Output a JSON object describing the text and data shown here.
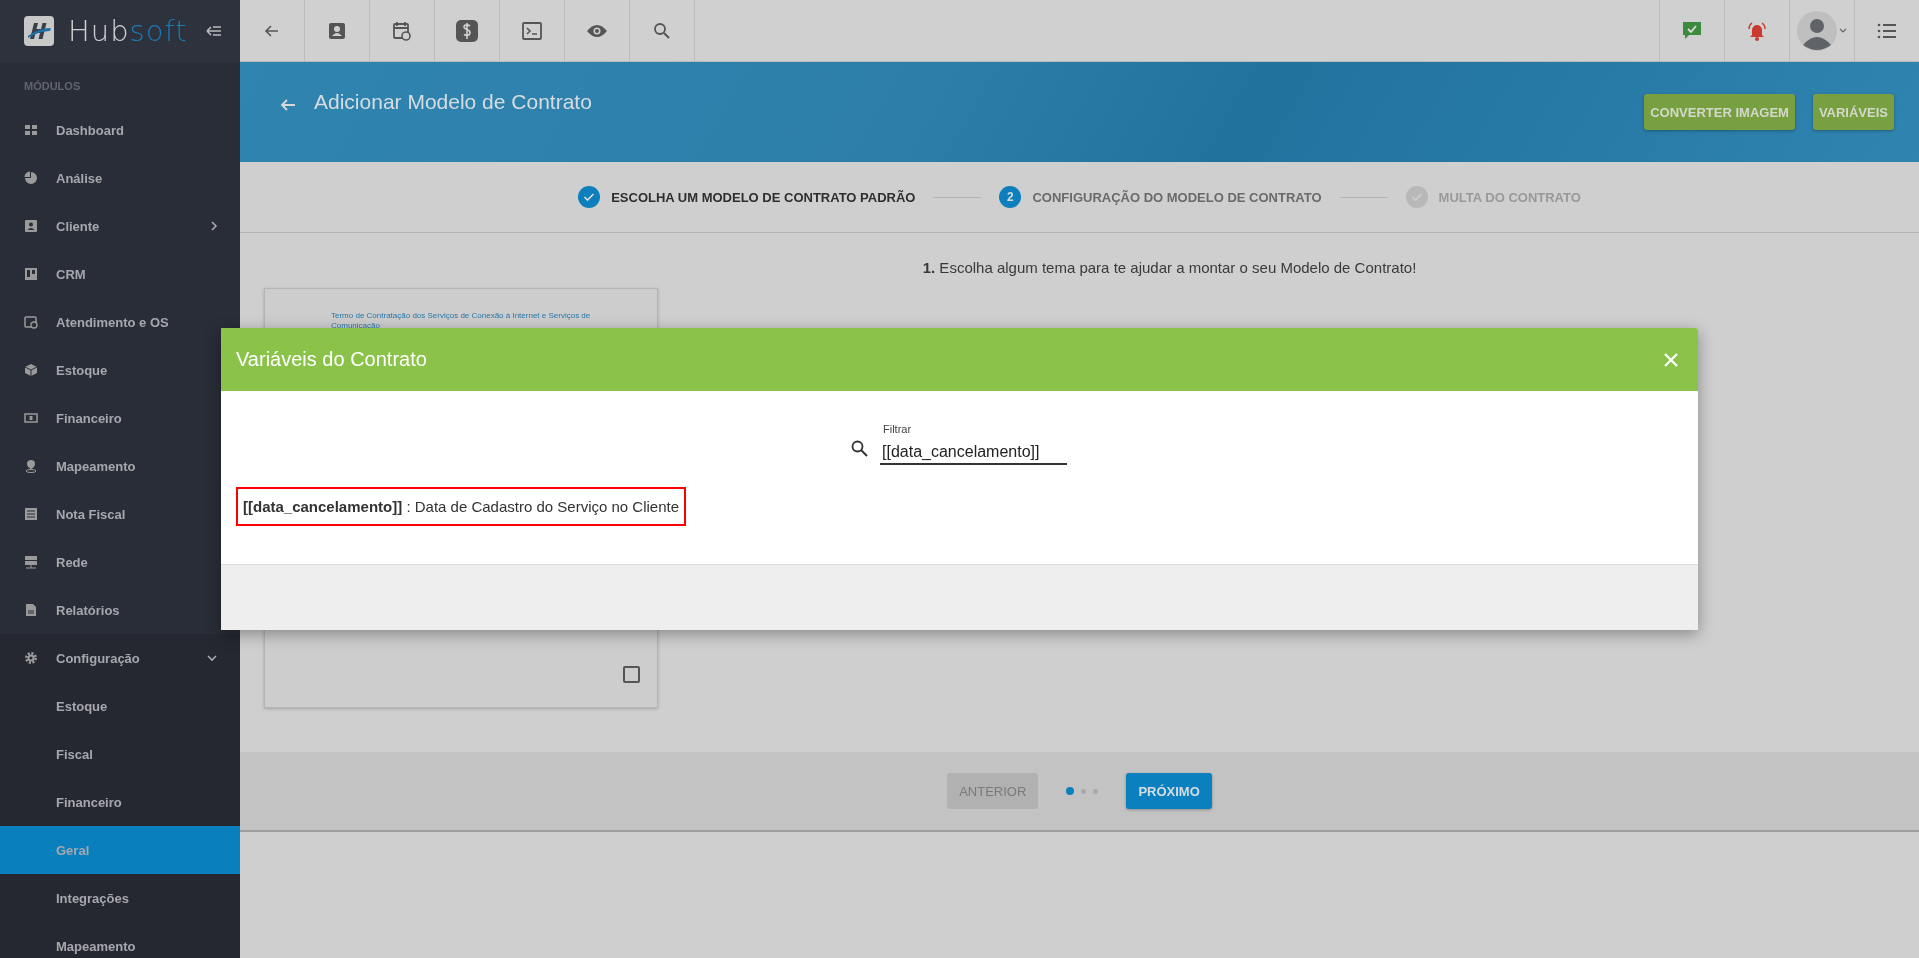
{
  "sidebar": {
    "brand_main": "Hub",
    "brand_accent": "soft",
    "section_label": "MÓDULOS",
    "items": [
      {
        "label": "Dashboard",
        "selected": false
      },
      {
        "label": "Análise",
        "selected": false
      },
      {
        "label": "Cliente",
        "selected": false,
        "expanded": false
      },
      {
        "label": "CRM",
        "selected": false
      },
      {
        "label": "Atendimento e OS",
        "selected": false
      },
      {
        "label": "Estoque",
        "selected": false
      },
      {
        "label": "Financeiro",
        "selected": false
      },
      {
        "label": "Mapeamento",
        "selected": false
      },
      {
        "label": "Nota Fiscal",
        "selected": false
      },
      {
        "label": "Rede",
        "selected": false
      },
      {
        "label": "Relatórios",
        "selected": false
      },
      {
        "label": "Configuração",
        "selected": false,
        "expanded": true,
        "children": [
          {
            "label": "Estoque",
            "selected": false
          },
          {
            "label": "Fiscal",
            "selected": false
          },
          {
            "label": "Financeiro",
            "selected": false
          },
          {
            "label": "Geral",
            "selected": true
          },
          {
            "label": "Integrações",
            "selected": false
          },
          {
            "label": "Mapeamento",
            "selected": false
          }
        ]
      }
    ]
  },
  "header": {
    "title": "Adicionar Modelo de Contrato",
    "buttons": [
      "CONVERTER IMAGEM",
      "VARIÁVEIS"
    ]
  },
  "stepper": [
    {
      "label": "ESCOLHA UM MODELO DE CONTRATO PADRÃO",
      "completed": true,
      "selected": false
    },
    {
      "label": "CONFIGURAÇÃO DO MODELO DE CONTRATO",
      "completed": false,
      "selected": true,
      "number": "2"
    },
    {
      "label": "MULTA DO CONTRATO",
      "completed": false,
      "selected": false
    }
  ],
  "instruction": "**1.** Escolha algum tema para te ajudar a montar o seu Modelo de Contrato!",
  "template_card": {
    "title": "Termo de Contratação dos Serviços de Conexão à Internet e Serviços de Comunicação",
    "checked": false
  },
  "footer": {
    "previous": {
      "label": "ANTERIOR",
      "disabled": true
    },
    "next": {
      "label": "PRÓXIMO",
      "disabled": false
    },
    "dots": [
      {
        "selected": true
      },
      {
        "selected": false
      },
      {
        "selected": false
      }
    ]
  },
  "modal": {
    "title": "Variáveis do Contrato",
    "filter": {
      "label": "Filtrar",
      "value": "[[data_cancelamento]]"
    },
    "results": [
      {
        "text": "**[[data_cancelamento]]** : Data de Cadastro do Serviço no Cliente",
        "highlighted": true
      }
    ]
  }
}
